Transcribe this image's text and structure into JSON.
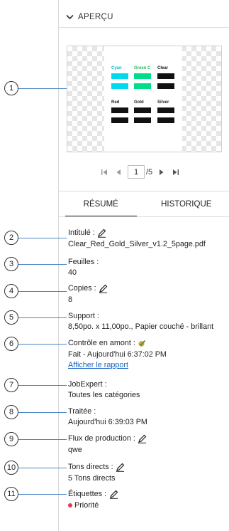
{
  "section": {
    "title": "APERÇU"
  },
  "preview": {
    "swatches": [
      {
        "label": "Cyan",
        "color": "#00d8f0",
        "label_color": "#00bcd4"
      },
      {
        "label": "Green C",
        "color": "#00dd88",
        "label_color": "#1db954"
      },
      {
        "label": "Clear",
        "color": "#111111",
        "label_color": "#111111"
      },
      {
        "label": "Red",
        "color": "#111111",
        "label_color": "#111111"
      },
      {
        "label": "Gold",
        "color": "#111111",
        "label_color": "#111111"
      },
      {
        "label": "Silver",
        "color": "#111111",
        "label_color": "#111111"
      }
    ]
  },
  "pager": {
    "current": "1",
    "total": "/5"
  },
  "tabs": [
    {
      "label": "RÉSUMÉ",
      "active": true
    },
    {
      "label": "HISTORIQUE",
      "active": false
    }
  ],
  "fields": {
    "title": {
      "label": "Intitulé :",
      "value": "Clear_Red_Gold_Silver_v1.2_5page.pdf"
    },
    "sheets": {
      "label": "Feuilles :",
      "value": "40"
    },
    "copies": {
      "label": "Copies :",
      "value": "8"
    },
    "media": {
      "label": "Support :",
      "value": "8,50po. x 11,00po., Papier couché - brillant"
    },
    "preflight": {
      "label": "Contrôle en amont :",
      "value": "Fait - Aujourd'hui 6:37:02 PM",
      "link": "Afficher le rapport"
    },
    "jobexpert": {
      "label": "JobExpert :",
      "value": "Toutes les catégories"
    },
    "processed": {
      "label": "Traitée :",
      "value": "Aujourd'hui 6:39:03 PM"
    },
    "workflow": {
      "label": "Flux de production :",
      "value": "qwe"
    },
    "spot": {
      "label": "Tons directs :",
      "value": "5 Tons directs"
    },
    "labels": {
      "label": "Étiquettes :",
      "value": "Priorité",
      "dot_color": "#e53950"
    }
  },
  "callouts": [
    "1",
    "2",
    "3",
    "4",
    "5",
    "6",
    "7",
    "8",
    "9",
    "10",
    "11"
  ],
  "colors": {
    "leader": "#4a86c5",
    "link": "#1565c0"
  }
}
